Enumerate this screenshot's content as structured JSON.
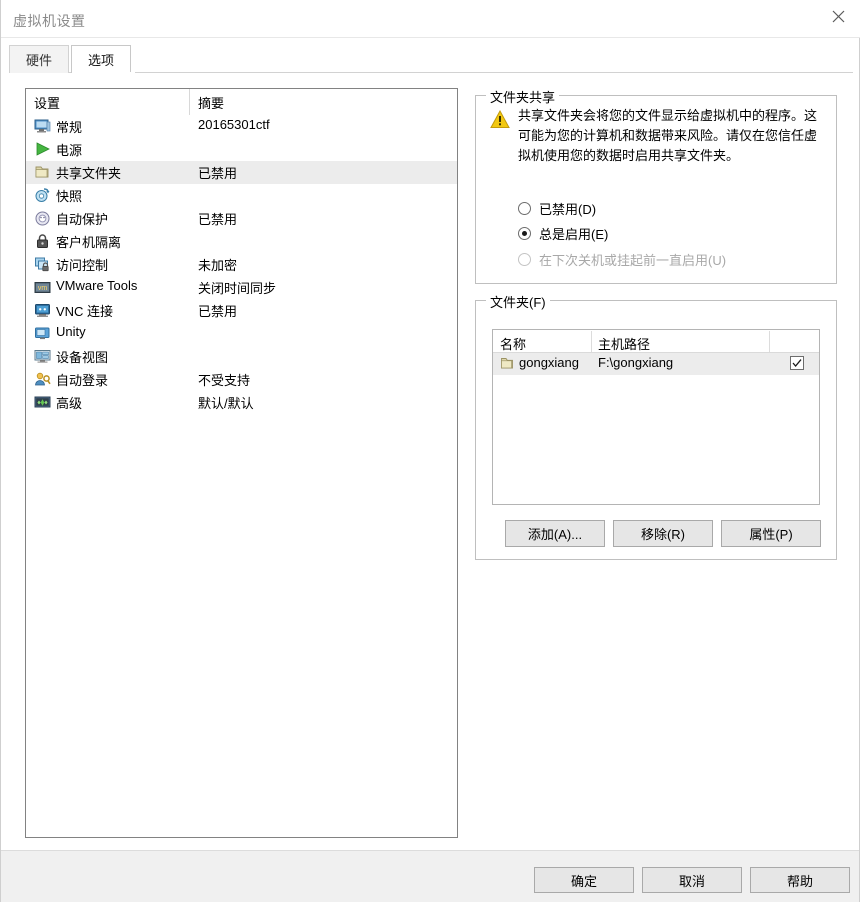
{
  "window": {
    "title": "虚拟机设置",
    "close_icon": "close-icon"
  },
  "tabs": [
    {
      "label": "硬件",
      "active": false
    },
    {
      "label": "选项",
      "active": true
    }
  ],
  "settings_list": {
    "headers": {
      "setting": "设置",
      "summary": "摘要"
    },
    "rows": [
      {
        "icon": "monitor-icon",
        "label": "常规",
        "summary": "20165301ctf",
        "selected": false
      },
      {
        "icon": "power-play-icon",
        "label": "电源",
        "summary": "",
        "selected": false
      },
      {
        "icon": "folder-icon",
        "label": "共享文件夹",
        "summary": "已禁用",
        "selected": true
      },
      {
        "icon": "snapshot-icon",
        "label": "快照",
        "summary": "",
        "selected": false
      },
      {
        "icon": "autoprotect-icon",
        "label": "自动保护",
        "summary": "已禁用",
        "selected": false
      },
      {
        "icon": "lock-icon",
        "label": "客户机隔离",
        "summary": "",
        "selected": false
      },
      {
        "icon": "access-control-icon",
        "label": "访问控制",
        "summary": "未加密",
        "selected": false
      },
      {
        "icon": "vmware-tools-icon",
        "label": "VMware Tools",
        "summary": "关闭时间同步",
        "selected": false
      },
      {
        "icon": "vnc-icon",
        "label": "VNC 连接",
        "summary": "已禁用",
        "selected": false
      },
      {
        "icon": "unity-icon",
        "label": "Unity",
        "summary": "",
        "selected": false
      },
      {
        "icon": "device-view-icon",
        "label": "设备视图",
        "summary": "",
        "selected": false
      },
      {
        "icon": "autologon-icon",
        "label": "自动登录",
        "summary": "不受支持",
        "selected": false
      },
      {
        "icon": "advanced-icon",
        "label": "高级",
        "summary": "默认/默认",
        "selected": false
      }
    ]
  },
  "sharing": {
    "legend": "文件夹共享",
    "warning_icon": "warning-triangle-icon",
    "warning_text": "共享文件夹会将您的文件显示给虚拟机中的程序。这可能为您的计算机和数据带来风险。请仅在您信任虚拟机使用您的数据时启用共享文件夹。",
    "options": [
      {
        "label": "已禁用(D)",
        "checked": false,
        "disabled": false
      },
      {
        "label": "总是启用(E)",
        "checked": true,
        "disabled": false
      },
      {
        "label": "在下次关机或挂起前一直启用(U)",
        "checked": false,
        "disabled": true
      }
    ]
  },
  "folders": {
    "legend": "文件夹(F)",
    "columns": [
      "名称",
      "主机路径"
    ],
    "rows": [
      {
        "icon": "folder-icon",
        "name": "gongxiang",
        "path": "F:\\gongxiang",
        "enabled": true
      }
    ],
    "buttons": {
      "add": "添加(A)...",
      "remove": "移除(R)",
      "properties": "属性(P)"
    }
  },
  "footer": {
    "ok": "确定",
    "cancel": "取消",
    "help": "帮助"
  },
  "colors": {
    "selection": "#ececec",
    "button_face": "#e6e6e6",
    "footer": "#f0f0f0",
    "warning": "#f5c518",
    "folder": "#d9cf9a"
  }
}
